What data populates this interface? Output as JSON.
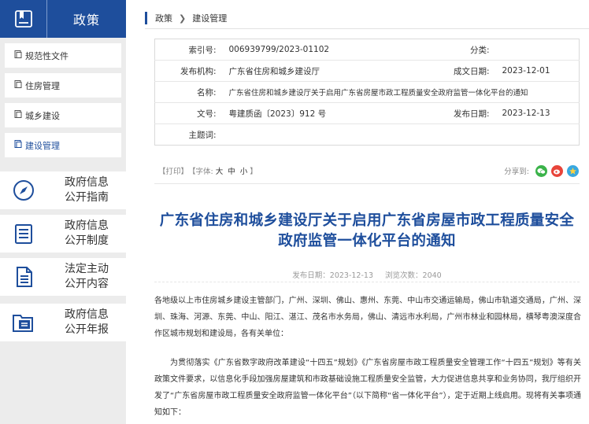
{
  "sidebar": {
    "title": "政策",
    "menu": [
      {
        "label": "规范性文件"
      },
      {
        "label": "住房管理"
      },
      {
        "label": "城乡建设"
      },
      {
        "label": "建设管理"
      }
    ],
    "big_items": [
      {
        "label": "政府信息\n公开指南",
        "icon": "compass-icon"
      },
      {
        "label": "政府信息\n公开制度",
        "icon": "document-list-icon"
      },
      {
        "label": "法定主动\n公开内容",
        "icon": "document-text-icon"
      },
      {
        "label": "政府信息\n公开年报",
        "icon": "report-folder-icon"
      }
    ]
  },
  "breadcrumb": {
    "items": [
      "政策",
      "建设管理"
    ]
  },
  "meta": {
    "index_label": "索引号:",
    "index_value": "006939799/2023-01102",
    "category_label": "分类:",
    "category_value": "",
    "publisher_label": "发布机构:",
    "publisher_value": "广东省住房和城乡建设厅",
    "created_label": "成文日期:",
    "created_value": "2023-12-01",
    "name_label": "名称:",
    "name_value": "广东省住房和城乡建设厅关于启用广东省房屋市政工程质量安全政府监管一体化平台的通知",
    "docno_label": "文号:",
    "docno_value": "粤建质函〔2023〕912 号",
    "pubdate_label": "发布日期:",
    "pubdate_value": "2023-12-13",
    "subject_label": "主题词:",
    "subject_value": ""
  },
  "toolbar": {
    "print": "【打印】",
    "font_label": "【字体:",
    "font_large": "大",
    "font_medium": "中",
    "font_small": "小",
    "font_close": "】",
    "share_label": "分享到:"
  },
  "article": {
    "title": "广东省住房和城乡建设厅关于启用广东省房屋市政工程质量安全政府监管一体化平台的通知",
    "pub_date": "发布日期：2023-12-13",
    "views": "浏览次数：2040",
    "para1": "各地级以上市住房城乡建设主管部门，广州、深圳、佛山、惠州、东莞、中山市交通运输局，佛山市轨道交通局，广州、深圳、珠海、河源、东莞、中山、阳江、湛江、茂名市水务局，佛山、清远市水利局，广州市林业和园林局，横琴粤澳深度合作区城市规划和建设局，各有关单位：",
    "para2": "为贯彻落实《广东省数字政府改革建设“十四五”规划》《广东省房屋市政工程质量安全管理工作“十四五”规划》等有关政策文件要求，以信息化手段加强房屋建筑和市政基础设施工程质量安全监管，大力促进信息共享和业务协同，我厅组织开发了“广东省房屋市政工程质量安全政府监管一体化平台”（以下简称“省一体化平台”），定于近期上线启用。现将有关事项通知如下："
  },
  "colors": {
    "brand": "#1e4e9c",
    "sidebar_bg": "#ececec"
  }
}
